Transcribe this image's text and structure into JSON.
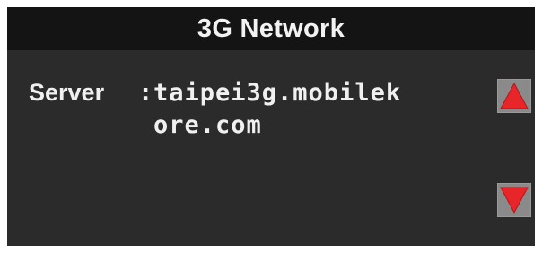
{
  "header": {
    "title": "3G Network"
  },
  "server": {
    "label": "Server",
    "separator": ":",
    "value": "taipei3g.mobilekore.com"
  },
  "scroll": {
    "up_icon": "triangle-up-icon",
    "down_icon": "triangle-down-icon"
  },
  "colors": {
    "title_bar": "#141414",
    "background": "#2b2b2b",
    "text": "#f0f0f0",
    "button": "#8a8a8a",
    "arrow": "#e8262a"
  }
}
